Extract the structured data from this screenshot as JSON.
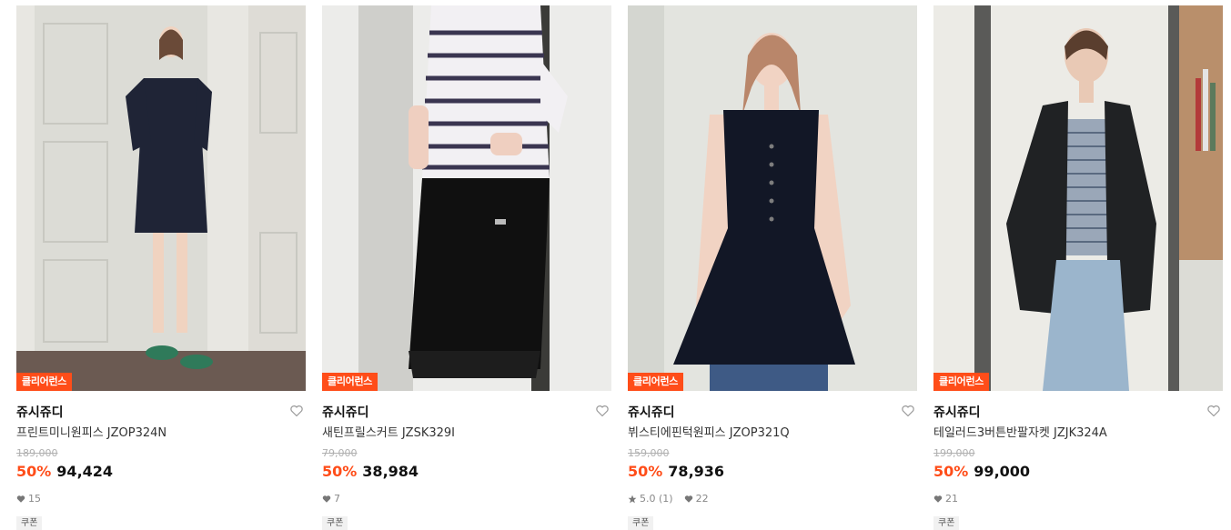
{
  "products": [
    {
      "badge": "클리어런스",
      "brand": "쥬시쥬디",
      "name": "프린트미니원피스 JZOP324N",
      "original_price": "189,000",
      "discount": "50%",
      "price": "94,424",
      "rating": "",
      "likes": "15",
      "tag": "쿠폰"
    },
    {
      "badge": "클리어런스",
      "brand": "쥬시쥬디",
      "name": "새틴프릴스커트 JZSK329I",
      "original_price": "79,000",
      "discount": "50%",
      "price": "38,984",
      "rating": "",
      "likes": "7",
      "tag": "쿠폰"
    },
    {
      "badge": "클리어런스",
      "brand": "쥬시쥬디",
      "name": "뷔스티에핀턱원피스 JZOP321Q",
      "original_price": "159,000",
      "discount": "50%",
      "price": "78,936",
      "rating": "5.0 (1)",
      "likes": "22",
      "tag": "쿠폰"
    },
    {
      "badge": "클리어런스",
      "brand": "쥬시쥬디",
      "name": "테일러드3버튼반팔자켓 JZJK324A",
      "original_price": "199,000",
      "discount": "50%",
      "price": "99,000",
      "rating": "",
      "likes": "21",
      "tag": "쿠폰"
    }
  ],
  "colors": {
    "accent": "#ff4d19",
    "muted": "#888888",
    "strike": "#b0b0b0"
  }
}
